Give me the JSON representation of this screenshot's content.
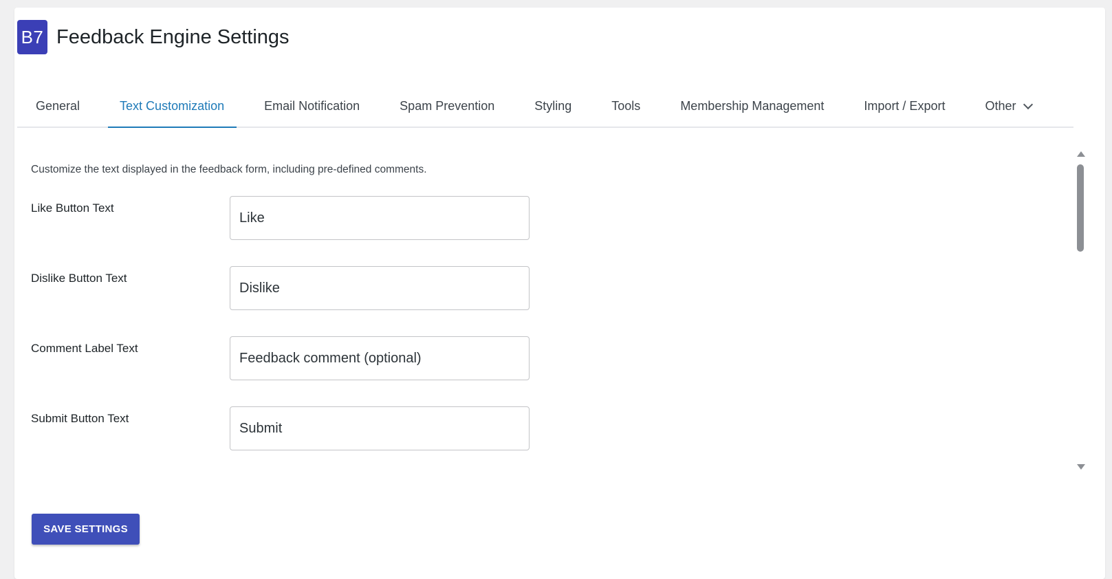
{
  "header": {
    "logo_text": "B7",
    "title": "Feedback Engine Settings"
  },
  "tabs": [
    {
      "label": "General",
      "active": false
    },
    {
      "label": "Text Customization",
      "active": true
    },
    {
      "label": "Email Notification",
      "active": false
    },
    {
      "label": "Spam Prevention",
      "active": false
    },
    {
      "label": "Styling",
      "active": false
    },
    {
      "label": "Tools",
      "active": false
    },
    {
      "label": "Membership Management",
      "active": false
    },
    {
      "label": "Import / Export",
      "active": false
    },
    {
      "label": "Other",
      "active": false,
      "has_dropdown": true
    }
  ],
  "content": {
    "description": "Customize the text displayed in the feedback form, including pre-defined comments.",
    "fields": [
      {
        "label": "Like Button Text",
        "value": "Like"
      },
      {
        "label": "Dislike Button Text",
        "value": "Dislike"
      },
      {
        "label": "Comment Label Text",
        "value": "Feedback comment (optional)"
      },
      {
        "label": "Submit Button Text",
        "value": "Submit"
      }
    ]
  },
  "actions": {
    "save_label": "SAVE SETTINGS"
  },
  "colors": {
    "brand": "#3b3fb6",
    "active_tab": "#1e7ab8",
    "save_button": "#3f4fb9"
  },
  "icons": {
    "tab_dropdown": "chevron-down-icon",
    "scroll_up": "scroll-up-arrow-icon",
    "scroll_down": "scroll-down-arrow-icon"
  }
}
